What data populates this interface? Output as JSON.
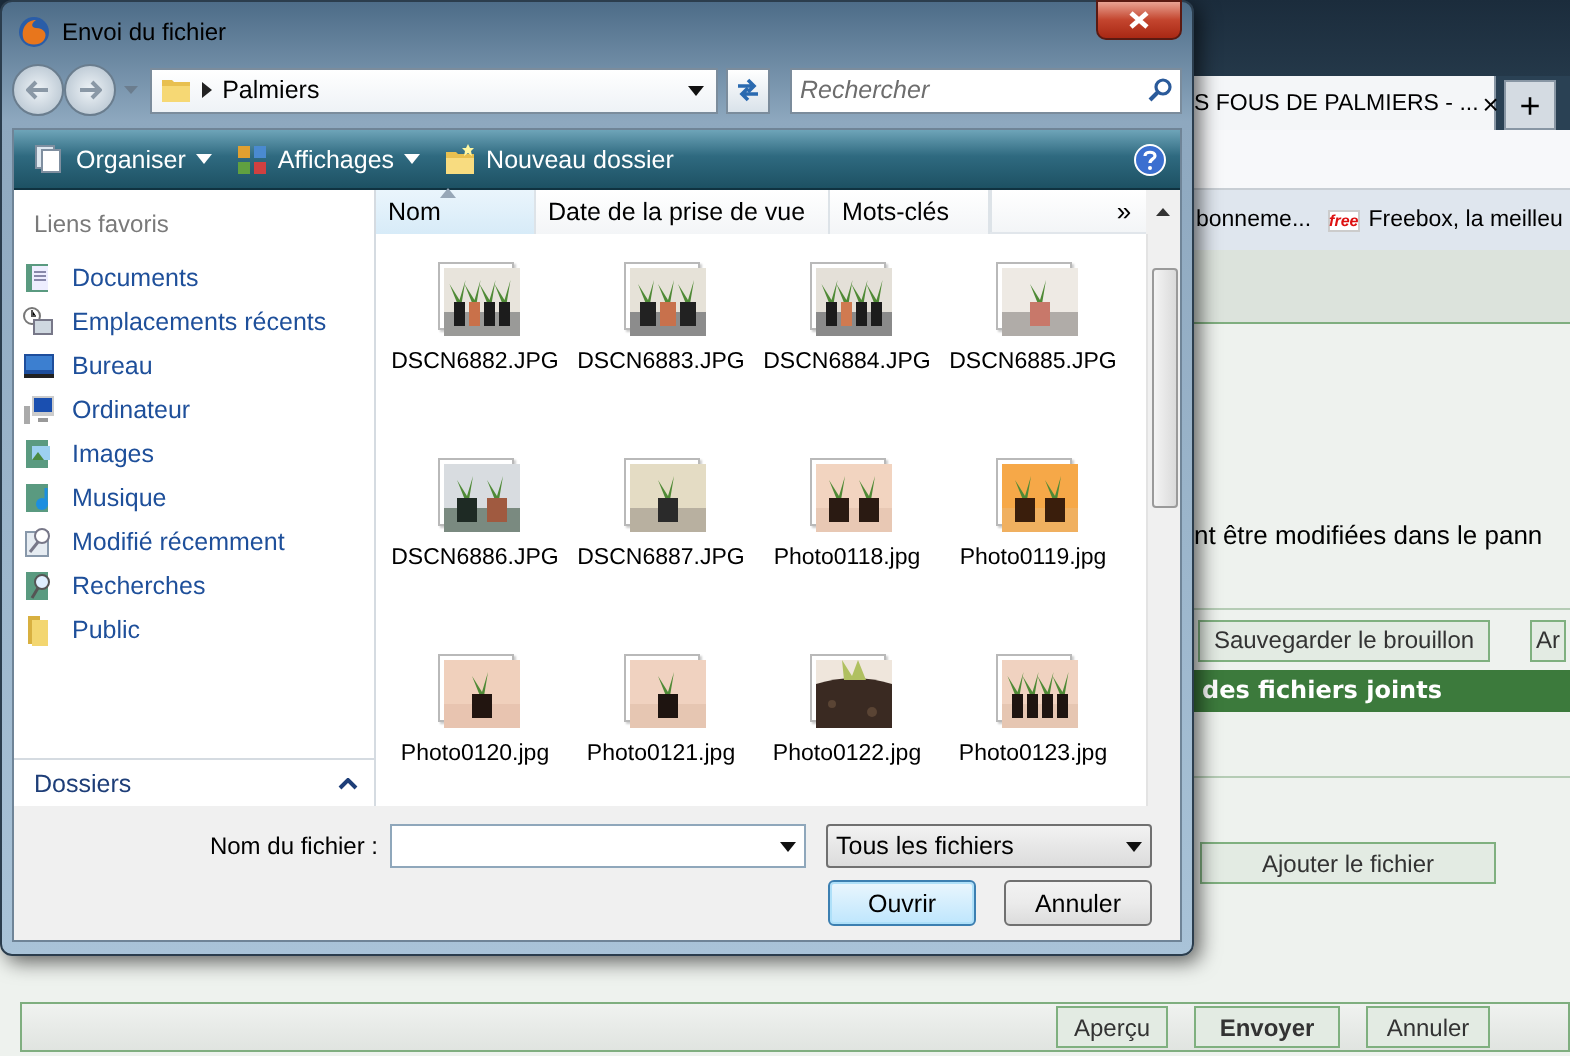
{
  "browser": {
    "tab": {
      "title": "S FOUS DE PALMIERS - ...",
      "close": "×"
    },
    "new_tab": "+",
    "bookmarks": [
      {
        "label": "bonneme..."
      },
      {
        "label": "Freebox, la meilleu",
        "badge": "free"
      }
    ],
    "page": {
      "notice": "nt être modifiées dans le pann",
      "draft_buttons": [
        "Sauvegarder le brouillon",
        "Ar"
      ],
      "section_title": "des fichiers joints",
      "add_file_button": "Ajouter le fichier",
      "bottom_buttons": [
        {
          "label": "Aperçu",
          "primary": false
        },
        {
          "label": "Envoyer",
          "primary": true
        },
        {
          "label": "Annuler",
          "primary": false
        }
      ]
    }
  },
  "dialog": {
    "title": "Envoi du fichier",
    "path": "Palmiers",
    "search": {
      "placeholder": "Rechercher"
    },
    "toolbar": [
      {
        "label": "Organiser",
        "dropdown": true
      },
      {
        "label": "Affichages",
        "dropdown": true
      },
      {
        "label": "Nouveau dossier",
        "dropdown": false
      }
    ],
    "favorites_heading": "Liens favoris",
    "favorites": [
      {
        "label": "Documents"
      },
      {
        "label": "Emplacements récents"
      },
      {
        "label": "Bureau"
      },
      {
        "label": "Ordinateur"
      },
      {
        "label": "Images"
      },
      {
        "label": "Musique"
      },
      {
        "label": "Modifié récemment"
      },
      {
        "label": "Recherches"
      },
      {
        "label": "Public"
      }
    ],
    "folders_label": "Dossiers",
    "columns": [
      {
        "label": "Nom",
        "sorted": true
      },
      {
        "label": "Date de la prise de vue",
        "sorted": false
      },
      {
        "label": "Mots-clés",
        "sorted": false
      }
    ],
    "more_columns": "»",
    "files": [
      {
        "name": "DSCN6882.JPG",
        "kind": "picture"
      },
      {
        "name": "DSCN6883.JPG",
        "kind": "picture"
      },
      {
        "name": "DSCN6884.JPG",
        "kind": "picture"
      },
      {
        "name": "DSCN6885.JPG",
        "kind": "picture"
      },
      {
        "name": "DSCN6886.JPG",
        "kind": "picture"
      },
      {
        "name": "DSCN6887.JPG",
        "kind": "picture"
      },
      {
        "name": "Photo0118.jpg",
        "kind": "picture"
      },
      {
        "name": "Photo0119.jpg",
        "kind": "picture"
      },
      {
        "name": "Photo0120.jpg",
        "kind": "picture"
      },
      {
        "name": "Photo0121.jpg",
        "kind": "picture"
      },
      {
        "name": "Photo0122.jpg",
        "kind": "picture"
      },
      {
        "name": "Photo0123.jpg",
        "kind": "picture"
      }
    ],
    "filename_label": "Nom du fichier :",
    "file_type": "Tous les fichiers",
    "buttons": [
      {
        "label": "Ouvrir",
        "default": true
      },
      {
        "label": "Annuler",
        "default": false
      }
    ]
  }
}
